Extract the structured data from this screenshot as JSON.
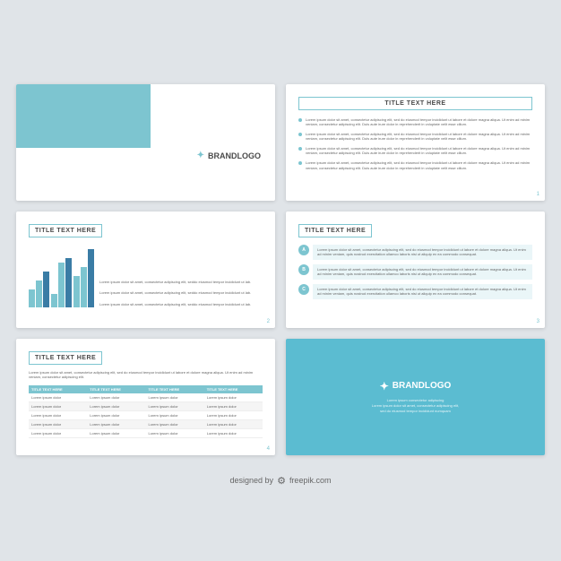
{
  "slides": {
    "slide1": {
      "brand": "BRANDLOGO"
    },
    "slide2": {
      "title": "TITLE TEXT HERE",
      "bullets": [
        "Lorem ipsum dolor sit amet, consectetur adipiscing elit, sed do eiusmod tempor incididunt ut labore et dolore magna aliqua. Ut enim ad minim veniam, consectetur adipiscing elit. Duis aute irure dolor in reprehenderit in voluptate velit esse cillum.",
        "Lorem ipsum dolor sit amet, consectetur adipiscing elit, sed do eiusmod tempor incididunt ut labore et dolore magna aliqua. Ut enim ad minim veniam, consectetur adipiscing elit. Duis aute irure dolor in reprehenderit in voluptate velit esse cillum.",
        "Lorem ipsum dolor sit amet, consectetur adipiscing elit, sed do eiusmod tempor incididunt ut labore et dolore magna aliqua. Ut enim ad minim veniam, consectetur adipiscing elit. Duis aute irure dolor in reprehenderit in voluptate velit esse cillum.",
        "Lorem ipsum dolor sit amet, consectetur adipiscing elit, sed do eiusmod tempor incididunt ut labore et dolore magna aliqua. Ut enim ad minim veniam, consectetur adipiscing elit. Duis aute irure dolor in reprehenderit in voluptate velit esse cillum."
      ],
      "slide_num": "1"
    },
    "slide3": {
      "title": "TITLE TEXT HERE",
      "text_items": [
        "Lorem ipsum dolor sit amet, consectetur adipiscing elit, seddo eiusmod tempor incididunt ut lab.",
        "Lorem ipsum dolor sit amet, consectetur adipiscing elit, seddo eiusmod tempor incididunt ut lab.",
        "Lorem ipsum dolor sit amet, consectetur adipiscing elit, seddo eiusmod tempor incididunt ut lab."
      ],
      "slide_num": "2"
    },
    "slide4": {
      "title": "TITLE TEXT HERE",
      "steps": [
        {
          "label": "A",
          "text": "Lorem ipsum dolor sit amet, consectetur adipiscing elit, sed do eiusmod tempor incididunt ut labore et dolore magna aliqua. Ut enim ad minim veniam, quis nostrud exercitation ullamco laboris nisi ut aliquip ex ea commodo consequat."
        },
        {
          "label": "B",
          "text": "Lorem ipsum dolor sit amet, consectetur adipiscing elit, sed do eiusmod tempor incididunt ut labore et dolore magna aliqua. Ut enim ad minim veniam, quis nostrud exercitation ullamco laboris nisi ut aliquip ex ea commodo consequat."
        },
        {
          "label": "C",
          "text": "Lorem ipsum dolor sit amet, consectetur adipiscing elit, sed do eiusmod tempor incididunt ut labore et dolore magna aliqua. Ut enim ad minim veniam, quis nostrud exercitation ullamco laboris nisi ut aliquip ex ea commodo consequat."
        }
      ],
      "slide_num": "3"
    },
    "slide5": {
      "title": "TITLE TEXT HERE",
      "intro": "Lorem ipsum dolor sit amet, consectetur adipiscing elit, sed do eiusmod tempor incididunt ut labore et dolore magna aliqua. Ut enim ad minim veniam, consectetur adipiscing elit.",
      "headers": [
        "TITLE TEXT HERE",
        "TITLE TEXT HERE",
        "TITLE TEXT HERE",
        "TITLE TEXT HERE"
      ],
      "rows": [
        [
          "Lorem ipsum dolor",
          "Lorem ipsum dolor",
          "Lorem ipsum dolor",
          "Lorem ipsum dolor"
        ],
        [
          "Lorem ipsum dolor",
          "Lorem ipsum dolor",
          "Lorem ipsum dolor",
          "Lorem ipsum dolor"
        ],
        [
          "Lorem ipsum dolor",
          "Lorem ipsum dolor",
          "Lorem ipsum dolor",
          "Lorem ipsum dolor"
        ],
        [
          "Lorem ipsum dolor",
          "Lorem ipsum dolor",
          "Lorem ipsum dolor",
          "Lorem ipsum dolor"
        ],
        [
          "Lorem ipsum dolor",
          "Lorem ipsum dolor",
          "Lorem ipsum dolor",
          "Lorem ipsum dolor"
        ]
      ],
      "slide_num": "4"
    },
    "slide6": {
      "brand": "BRANDLOGO",
      "tagline": "Lorem ipsum consectetur adipiscing\nLorem ipsum dolor sit amet, consectetur adipiscing elit,\nsed do eiusmod tempor incididunt numquam"
    }
  },
  "footer": {
    "text": "designed by",
    "site": "freepik.com"
  },
  "colors": {
    "blue": "#5bbcd1",
    "dark_blue": "#3a7ca5",
    "light_blue": "#7dc5d0",
    "bg": "#e0e4e8"
  }
}
